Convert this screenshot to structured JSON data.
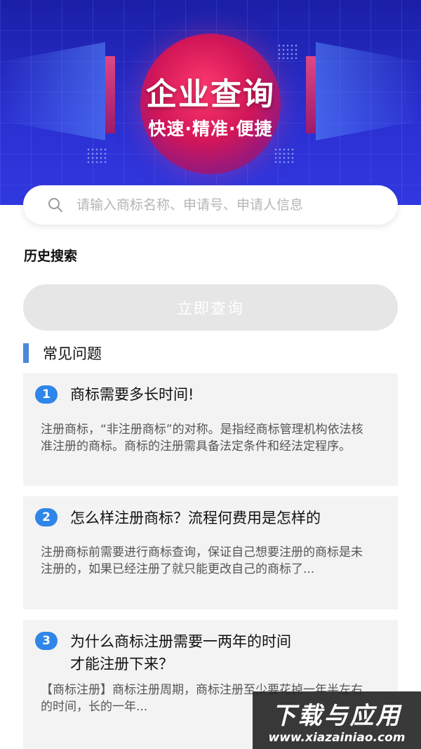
{
  "banner": {
    "title": "企业查询",
    "subtitle": "快速·精准·便捷"
  },
  "search": {
    "placeholder": "请输入商标名称、申请号、申请人信息",
    "icon": "search-icon"
  },
  "history": {
    "label": "历史搜索"
  },
  "query_button": {
    "label": "立即查询"
  },
  "faq": {
    "heading": "常见问题",
    "items": [
      {
        "number": "1",
        "question": "商标需要多长时间!",
        "answer": "注册商标，“非注册商标”的对称。是指经商标管理机构依法核准注册的商标。商标的注册需具备法定条件和经法定程序。"
      },
      {
        "number": "2",
        "question": "怎么样注册商标？流程何费用是怎样的",
        "answer": "注册商标前需要进行商标查询，保证自己想要注册的商标是未注册的，如果已经注册了就只能更改自己的商标了..."
      },
      {
        "number": "3",
        "question": "为什么商标注册需要一两年的时间\n才能注册下来？",
        "answer": "【商标注册】商标注册周期，商标注册至少要花掉一年半左右的时间，长的一年..."
      }
    ]
  },
  "watermark": {
    "main": "下载与应用",
    "url": "www.xiazainiao.com"
  },
  "colors": {
    "banner_bg": "#2a2fd0",
    "accent": "#2f86e8",
    "marker": "#4a8ad8",
    "button_disabled": "#e6e6e6",
    "card_bg": "#f3f3f3"
  }
}
